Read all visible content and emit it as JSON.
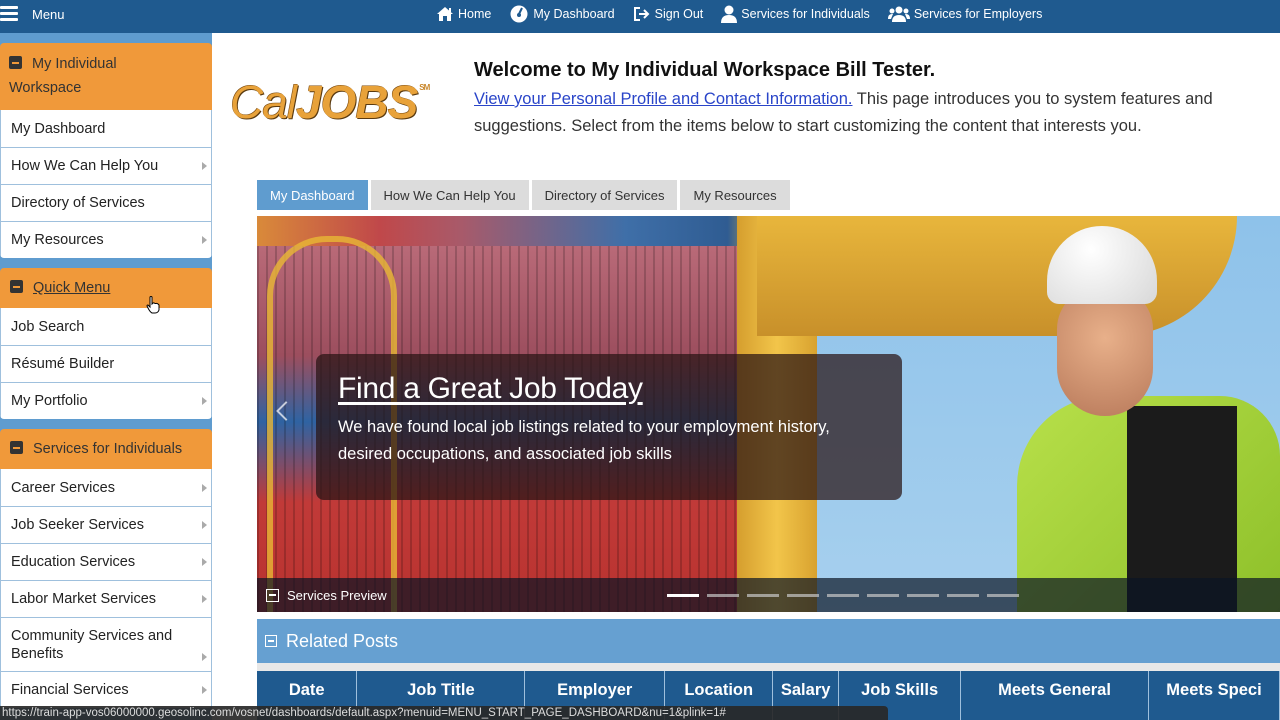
{
  "topbar": {
    "menu_label": "Menu",
    "nav": [
      {
        "label": "Home",
        "icon": "home-icon"
      },
      {
        "label": "My Dashboard",
        "icon": "dashboard-gauge-icon"
      },
      {
        "label": "Sign Out",
        "icon": "sign-out-icon"
      },
      {
        "label": "Services for Individuals",
        "icon": "user-icon"
      },
      {
        "label": "Services for Employers",
        "icon": "users-group-icon"
      }
    ]
  },
  "sidebar": {
    "panels": [
      {
        "title": "My Individual Workspace",
        "title_line1": "My Individual",
        "title_line2": "Workspace",
        "items": [
          {
            "label": "My Dashboard",
            "has_submenu": false
          },
          {
            "label": "How We Can Help You",
            "has_submenu": true
          },
          {
            "label": "Directory of Services",
            "has_submenu": false
          },
          {
            "label": "My Resources",
            "has_submenu": true
          }
        ]
      },
      {
        "title": "Quick Menu",
        "items": [
          {
            "label": "Job Search",
            "has_submenu": false
          },
          {
            "label": "Résumé Builder",
            "has_submenu": false
          },
          {
            "label": "My Portfolio",
            "has_submenu": true
          }
        ]
      },
      {
        "title": "Services for Individuals",
        "items": [
          {
            "label": "Career Services",
            "has_submenu": true
          },
          {
            "label": "Job Seeker Services",
            "has_submenu": true
          },
          {
            "label": "Education Services",
            "has_submenu": true
          },
          {
            "label": "Labor Market Services",
            "has_submenu": true
          },
          {
            "label": "Community Services and Benefits",
            "line1": "Community Services and",
            "line2": "Benefits",
            "has_submenu": true
          },
          {
            "label": "Financial Services",
            "has_submenu": true
          }
        ]
      }
    ]
  },
  "header": {
    "logo_text_cal": "Cal",
    "logo_text_jobs": "JOBS",
    "logo_mark": "SM",
    "welcome_title": "Welcome to My Individual Workspace Bill Tester.",
    "profile_link": "View your Personal Profile and Contact Information.",
    "intro_line1_rest": " This page introduces you to system features and",
    "intro_line2": "suggestions. Select from the items below to start customizing the content that interests you."
  },
  "tabs": [
    {
      "label": "My Dashboard",
      "active": true
    },
    {
      "label": "How We Can Help You",
      "active": false
    },
    {
      "label": "Directory of Services",
      "active": false
    },
    {
      "label": "My Resources",
      "active": false
    }
  ],
  "hero": {
    "title": "Find a Great Job Today",
    "text_line1": "We have found local job listings related to your employment history,",
    "text_line2": "desired occupations, and associated job skills",
    "footer_label": "Services Preview",
    "slide_count": 9,
    "active_slide": 1
  },
  "related_posts": {
    "title": "Related Posts",
    "columns": [
      "Date",
      "Job Title",
      "Employer",
      "Location",
      "Salary",
      "Job Skills Matched",
      "Meets General Requirements",
      "Meets Special Requirements"
    ],
    "columns_visible_line1": [
      "Date",
      "Job Title",
      "Employer",
      "Location",
      "Salary",
      "Job Skills",
      "Meets General",
      "Meets Speci"
    ]
  },
  "statusbar": {
    "url": "https://train-app-vos06000000.geosolinc.com/vosnet/dashboards/default.aspx?menuid=MENU_START_PAGE_DASHBOARD&nu=1&plink=1#"
  },
  "colors": {
    "topbar": "#1f5a8f",
    "sidebar_bg": "#5f9ccf",
    "panel_header": "#f0993a",
    "link": "#2a45c9",
    "tab_active": "#5f9ccf",
    "tab_inactive": "#dcdcdc"
  }
}
